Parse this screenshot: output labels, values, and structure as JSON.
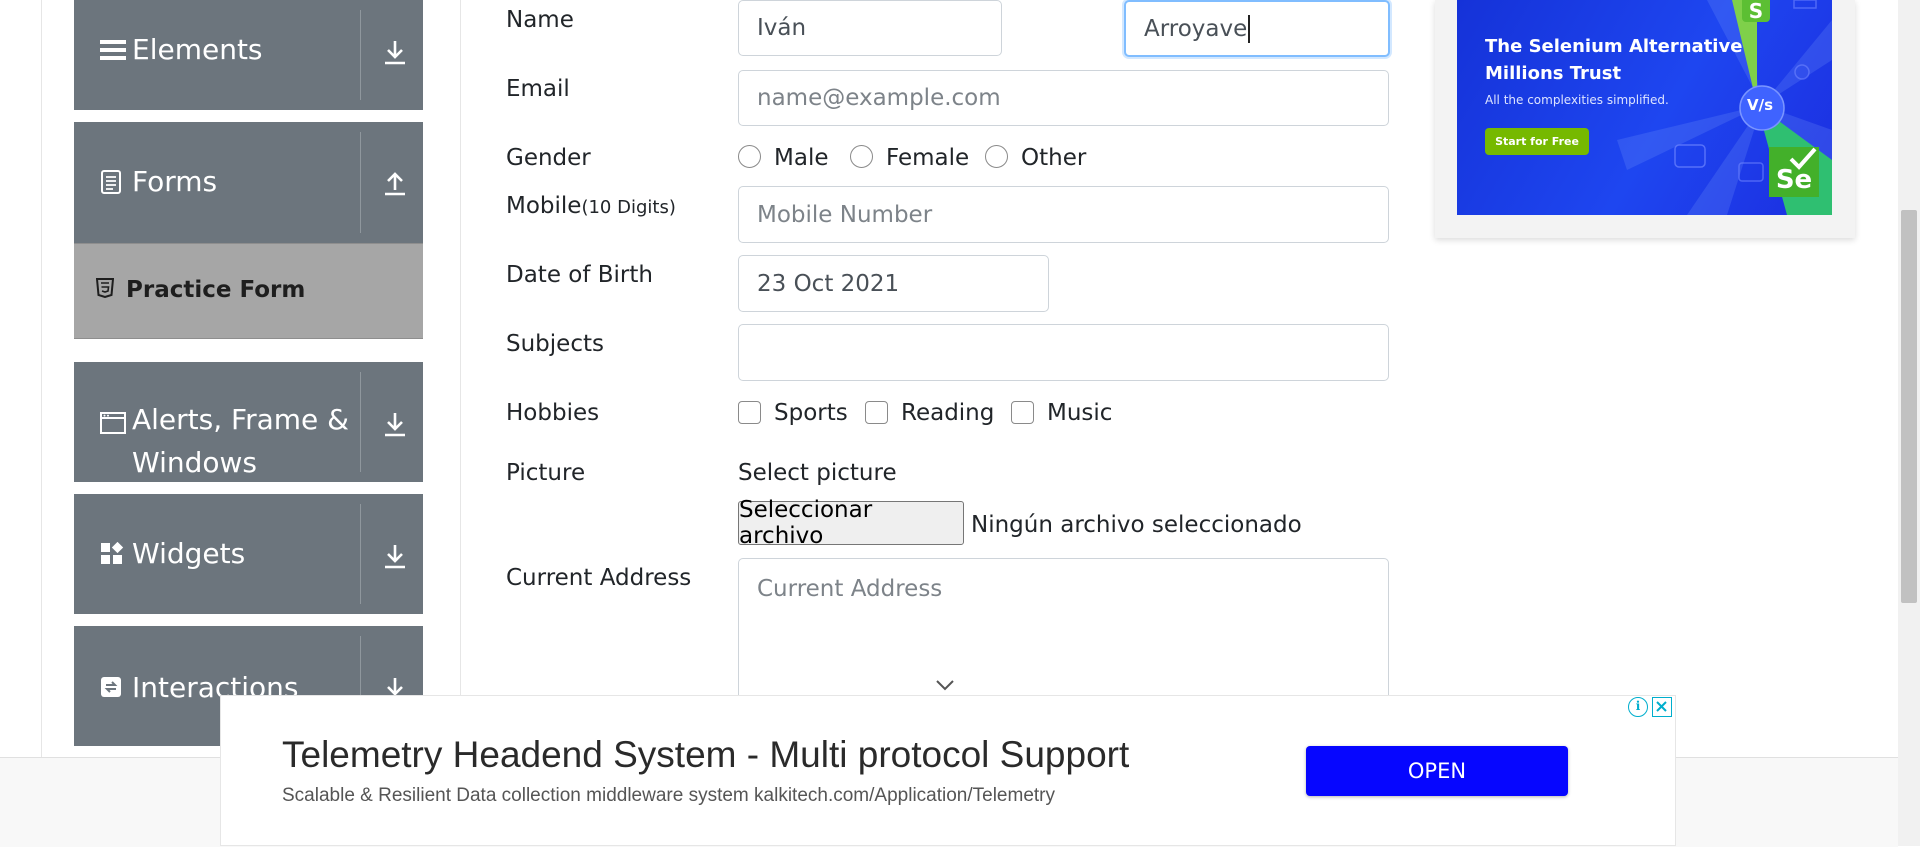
{
  "sidebar": {
    "groups": [
      {
        "label": "Elements",
        "icon": "hamburger-icon",
        "arrow": "download-arrow-icon"
      },
      {
        "label": "Forms",
        "icon": "document-icon",
        "arrow": "upload-arrow-icon"
      },
      {
        "label": "Alerts, Frame &",
        "label2": "Windows",
        "icon": "window-icon",
        "arrow": "download-arrow-icon"
      },
      {
        "label": "Widgets",
        "icon": "widgets-icon",
        "arrow": "download-arrow-icon"
      },
      {
        "label": "Interactions",
        "icon": "interactions-icon",
        "arrow": "download-arrow-icon"
      }
    ],
    "active_item": {
      "label": "Practice Form",
      "icon": "html5-icon"
    }
  },
  "form": {
    "name_label": "Name",
    "first_name_value": "Iván",
    "last_name_value": "Arroyave",
    "email_label": "Email",
    "email_placeholder": "name@example.com",
    "gender_label": "Gender",
    "gender_options": [
      "Male",
      "Female",
      "Other"
    ],
    "mobile_label": "Mobile",
    "mobile_hint": "(10 Digits)",
    "mobile_placeholder": "Mobile Number",
    "dob_label": "Date of Birth",
    "dob_value": "23 Oct 2021",
    "subjects_label": "Subjects",
    "subjects_value": "",
    "hobbies_label": "Hobbies",
    "hobbies_options": [
      "Sports",
      "Reading",
      "Music"
    ],
    "picture_label": "Picture",
    "select_picture": "Select picture",
    "file_button": "Seleccionar archivo",
    "file_status": "Ningún archivo seleccionado",
    "address_label": "Current Address",
    "address_placeholder": "Current Address"
  },
  "top_ad": {
    "headline_1": "The Selenium Alternative",
    "headline_2": "Millions Trust",
    "subline": "All the complexities simplified.",
    "cta": "Start for Free",
    "badge_vs": "V/s",
    "badge_se": "Se"
  },
  "bottom_ad": {
    "title": "Telemetry Headend System - Multi protocol Support",
    "subtitle": "Scalable & Resilient Data collection middleware system kalkitech.com/Application/Telemetry",
    "cta": "OPEN"
  },
  "colors": {
    "sidebar_bg": "#6c757d",
    "active_item_bg": "#a6a6a6",
    "focus_border": "#80bdff",
    "ad_button": "#0606ff",
    "ad_cta_green": "#76b900"
  }
}
